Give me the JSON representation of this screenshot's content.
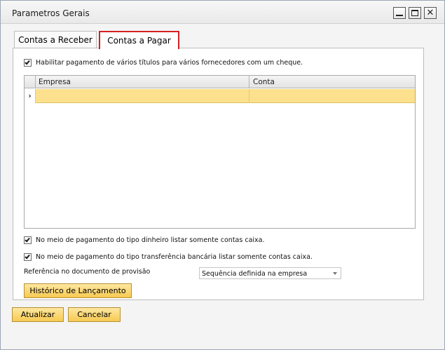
{
  "window": {
    "title": "Parametros Gerais"
  },
  "tabs": [
    {
      "label": "Contas a Receber",
      "active": false
    },
    {
      "label": "Contas a Pagar",
      "active": true
    }
  ],
  "options": {
    "multi_payment": {
      "label": "Habilitar pagamento de vários títulos para vários fornecedores com um cheque.",
      "checked": true
    },
    "cash_only": {
      "label": "No meio de pagamento do tipo dinheiro listar somente contas caixa.",
      "checked": true
    },
    "transfer_only": {
      "label": "No meio de pagamento do tipo transferência bancária listar somente contas caixa.",
      "checked": true
    }
  },
  "grid": {
    "columns": [
      "Empresa",
      "Conta"
    ],
    "row_marker": "›",
    "rows": [
      {
        "empresa": "",
        "conta": ""
      }
    ]
  },
  "provision_reference": {
    "label": "Referência no documento de provisão",
    "selected": "Sequência definida na empresa"
  },
  "buttons": {
    "history": "Histórico de Lançamento",
    "update": "Atualizar",
    "cancel": "Cancelar"
  },
  "colors": {
    "button_accent": "#f7ca52",
    "selected_row": "#fce08e",
    "active_tab_border": "#d62020"
  },
  "icons": {
    "minimize": "minimize-icon",
    "maximize": "maximize-icon",
    "close": "close-icon",
    "dropdown": "chevron-down-icon"
  }
}
